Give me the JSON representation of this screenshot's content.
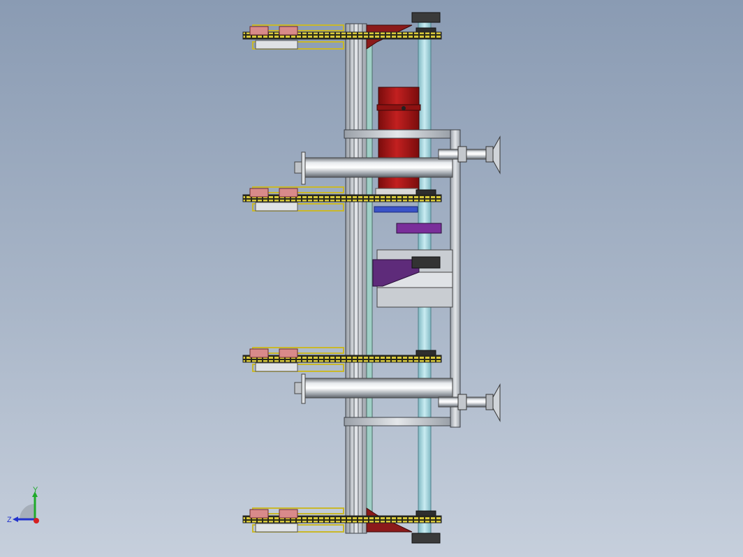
{
  "viewport": {
    "background_top": "#8a9bb3",
    "background_bottom": "#c6cfdc"
  },
  "triad": {
    "y_label": "Y",
    "z_label": "Z",
    "y_color": "#1faa2a",
    "z_color": "#2233cc",
    "x_color": "#d62020"
  },
  "model": {
    "chain_color": "#c9b82a",
    "motor_color": "#b01818",
    "bracket_color": "#8b1a1a",
    "purple_color": "#6a2a8a",
    "shaft_color": "#9fd6e0",
    "frame_color": "#c8ccd2"
  }
}
